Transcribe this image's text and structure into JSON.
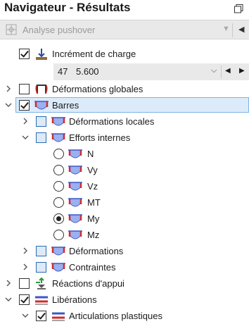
{
  "header": {
    "title": "Navigateur - Résultats"
  },
  "analysis": {
    "label": "Analyse pushover"
  },
  "increment": {
    "label": "Incrément de charge",
    "number": "47",
    "value": "5.600"
  },
  "tree": {
    "global_deformations": "Déformations globales",
    "members": "Barres",
    "local_deformations": "Déformations locales",
    "internal_forces": "Efforts internes",
    "forces": [
      "N",
      "Vy",
      "Vz",
      "MT",
      "My",
      "Mz"
    ],
    "selected_force": "My",
    "deformations": "Déformations",
    "stresses": "Contraintes",
    "support_reactions": "Réactions d'appui",
    "releases": "Libérations",
    "plastic_hinges": "Articulations plastiques"
  },
  "colors": {
    "selection_bg": "#dcebf9",
    "selection_border": "#7fb2e5",
    "accent_red": "#d22b2b",
    "accent_blue": "#3a58c9"
  }
}
